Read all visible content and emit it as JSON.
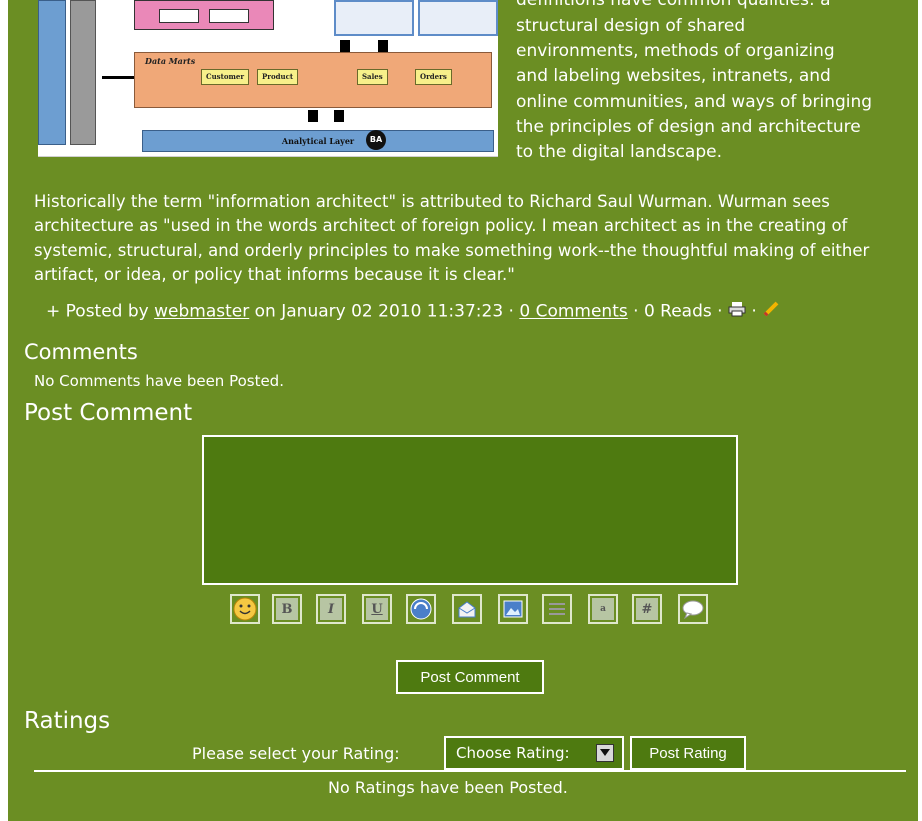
{
  "article": {
    "side_clipped_line": "definitions have common qualities: a",
    "side_lines": [
      "structural design of shared",
      "environments, methods of organizing",
      "and labeling websites, intranets, and",
      "online communities, and ways of bringing",
      "the principles of design and architecture",
      "to the digital landscape."
    ],
    "paragraph": "Historically the term \"information architect\" is attributed to Richard Saul Wurman. Wurman sees architecture as \"used in the words architect of foreign policy. I mean architect as in the creating of systemic, structural, and orderly principles to make something work--the thoughtful making of either artifact, or idea, or policy that informs because it is clear.\"",
    "figure": {
      "data_marts_label": "Data Marts",
      "chips": [
        "Customer",
        "Product",
        "Sales",
        "Orders"
      ],
      "analytical_label": "Analytical Layer",
      "ba_label": "BA"
    }
  },
  "posted": {
    "prefix": "+ Posted by",
    "author": "webmaster",
    "on_date": "on January 02 2010 11:37:23 ·",
    "comments_link": "0 Comments",
    "reads": "· 0 Reads ·",
    "sep": "·"
  },
  "comments": {
    "heading": "Comments",
    "empty": "No Comments have been Posted."
  },
  "post_comment": {
    "heading": "Post Comment",
    "textarea_value": "",
    "toolbar": [
      "smiley-icon",
      "bold-icon",
      "italic-icon",
      "underline-icon",
      "link-icon",
      "email-icon",
      "image-icon",
      "list-icon",
      "superscript-icon",
      "hash-icon",
      "quote-icon"
    ],
    "submit_label": "Post Comment"
  },
  "ratings": {
    "heading": "Ratings",
    "prompt": "Please select your Rating:",
    "select_value": "Choose Rating:",
    "submit_label": "Post Rating",
    "empty": "No Ratings have been Posted."
  },
  "colors": {
    "background": "#6b8e23",
    "textarea": "#4e7a10"
  }
}
